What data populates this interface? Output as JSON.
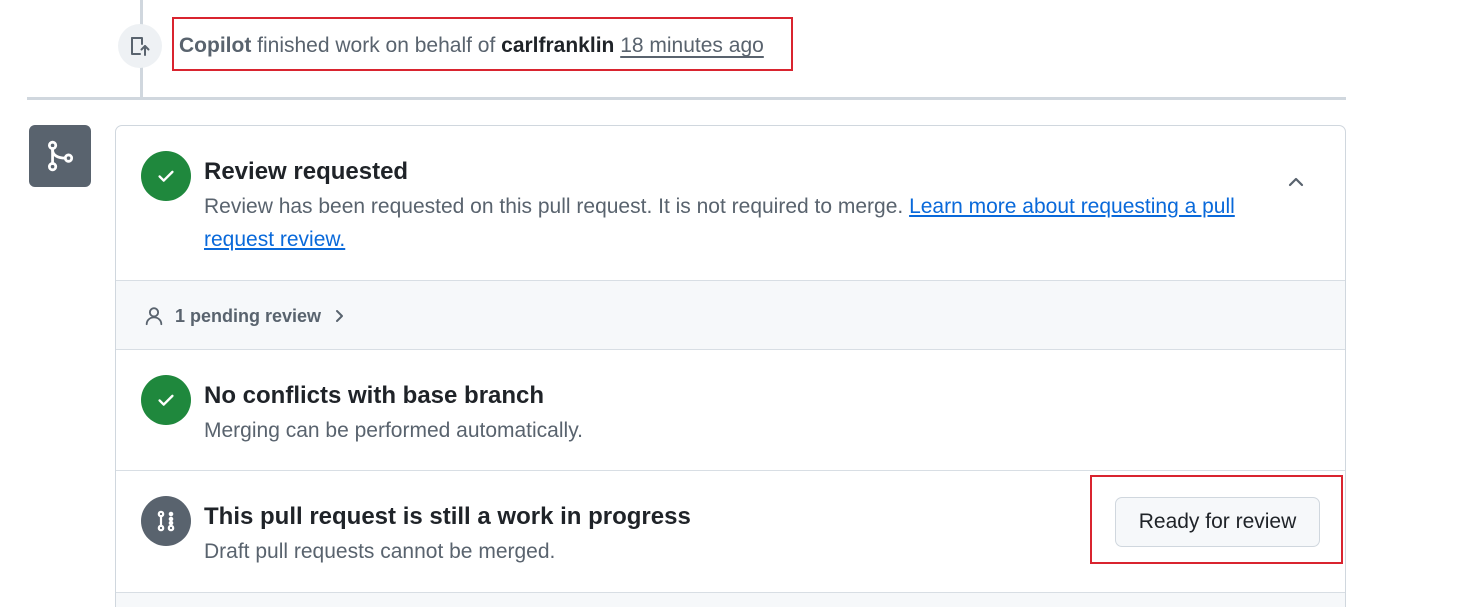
{
  "timeline_event": {
    "actor": "Copilot",
    "action_text": " finished work on behalf of ",
    "user": "carlfranklin",
    "time_ago": "18 minutes ago"
  },
  "review_section": {
    "title": "Review requested",
    "description": "Review has been requested on this pull request. It is not required to merge. ",
    "link_text": "Learn more about requesting a pull request review."
  },
  "pending_section": {
    "label": "1 pending review"
  },
  "conflicts_section": {
    "title": "No conflicts with base branch",
    "description": "Merging can be performed automatically."
  },
  "wip_section": {
    "title": "This pull request is still a work in progress",
    "description": "Draft pull requests cannot be merged.",
    "button_label": "Ready for review"
  },
  "colors": {
    "success": "#1f883d",
    "neutral": "#59636e",
    "link": "#0969da",
    "highlight": "#d9242f"
  },
  "icons": {
    "event": "git-pull-request-draft-icon",
    "merge": "git-merge-icon",
    "success": "check-icon",
    "collapse": "chevron-up-icon",
    "person": "person-icon",
    "expand": "chevron-right-icon",
    "draft": "git-pull-request-draft-icon"
  }
}
